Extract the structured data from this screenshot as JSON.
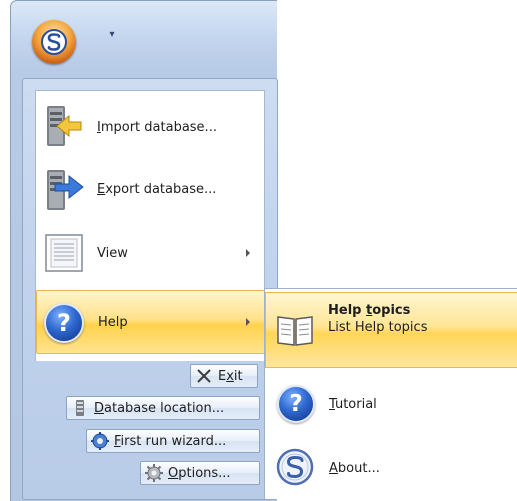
{
  "app_menu": {
    "items": [
      {
        "label": "Import database...",
        "accel": "I",
        "rest": "mport database..."
      },
      {
        "label": "Export database...",
        "accel": "E",
        "rest": "xport database..."
      },
      {
        "label": "View"
      },
      {
        "label": "Help"
      }
    ],
    "buttons": [
      {
        "pre": "E",
        "accel": "x",
        "rest": "it"
      },
      {
        "accel": "D",
        "rest": "atabase location..."
      },
      {
        "accel": "F",
        "rest": "irst run wizard..."
      },
      {
        "accel": "O",
        "rest": "ptions..."
      }
    ]
  },
  "help_submenu": {
    "topics": {
      "title_pre": "Help ",
      "title_accel": "t",
      "title_rest": "opics",
      "description": "List Help topics"
    },
    "tutorial": {
      "accel": "T",
      "rest": "utorial"
    },
    "about": {
      "accel": "A",
      "rest": "bout..."
    }
  },
  "colors": {
    "highlight": "#ffd24d",
    "accent": "#2f69cf",
    "app_button": "#f5a640"
  }
}
